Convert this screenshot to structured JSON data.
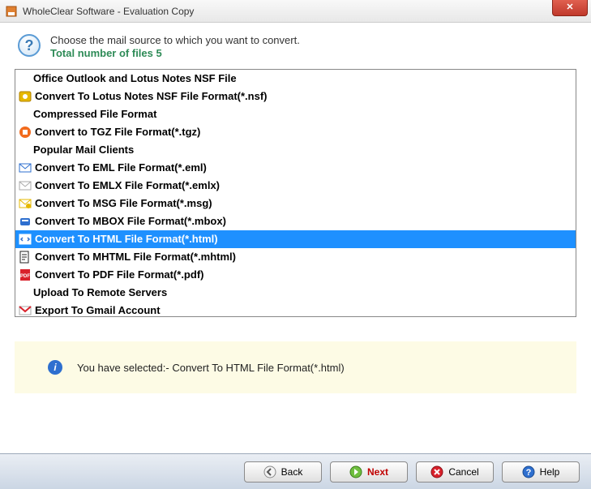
{
  "window": {
    "title": "WholeClear Software - Evaluation Copy"
  },
  "header": {
    "line1": "Choose the mail source to which you want to convert.",
    "line2": "Total number of files 5"
  },
  "list": [
    {
      "type": "header",
      "label": "Office Outlook and Lotus Notes NSF File"
    },
    {
      "type": "item",
      "icon": "nsf",
      "label": "Convert To Lotus Notes NSF File Format(*.nsf)"
    },
    {
      "type": "header",
      "label": "Compressed File Format"
    },
    {
      "type": "item",
      "icon": "tgz",
      "label": "Convert to TGZ File Format(*.tgz)"
    },
    {
      "type": "header",
      "label": "Popular Mail Clients"
    },
    {
      "type": "item",
      "icon": "eml",
      "label": "Convert To EML File Format(*.eml)"
    },
    {
      "type": "item",
      "icon": "emlx",
      "label": "Convert To EMLX File Format(*.emlx)"
    },
    {
      "type": "item",
      "icon": "msg",
      "label": "Convert To MSG File Format(*.msg)"
    },
    {
      "type": "item",
      "icon": "mbox",
      "label": "Convert To MBOX File Format(*.mbox)"
    },
    {
      "type": "item",
      "icon": "html",
      "label": "Convert To HTML File Format(*.html)",
      "selected": true
    },
    {
      "type": "item",
      "icon": "mhtml",
      "label": "Convert To MHTML File Format(*.mhtml)"
    },
    {
      "type": "item",
      "icon": "pdf",
      "label": "Convert To PDF File Format(*.pdf)"
    },
    {
      "type": "header",
      "label": "Upload To Remote Servers"
    },
    {
      "type": "item",
      "icon": "gmail",
      "label": "Export To Gmail Account"
    }
  ],
  "status": {
    "text": "You have selected:- Convert To HTML File Format(*.html)"
  },
  "buttons": {
    "back": "Back",
    "next": "Next",
    "cancel": "Cancel",
    "help": "Help"
  },
  "iconColors": {
    "nsf": "#e6b800",
    "tgz": "#f26b1d",
    "eml": "#2e6fcf",
    "emlx": "#cfd4da",
    "msg": "#e6b800",
    "mbox": "#2e6fcf",
    "html": "#2e6fcf",
    "mhtml": "#222",
    "pdf": "#d9212b",
    "gmail": "#d9212b"
  }
}
